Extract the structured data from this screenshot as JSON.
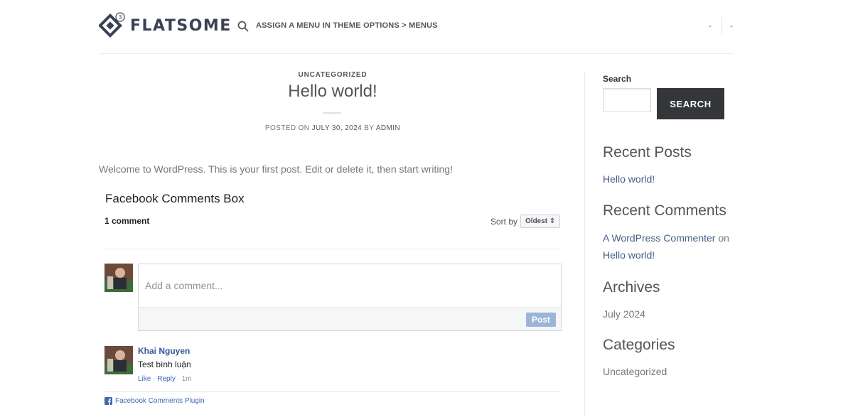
{
  "header": {
    "logo_text": "FLATSOME",
    "logo_version": "3",
    "menu_note": "ASSIGN A MENU IN THEME OPTIONS > MENUS",
    "right_item_1": "-",
    "right_item_2": "-"
  },
  "post": {
    "category": "UNCATEGORIZED",
    "title": "Hello world!",
    "meta_prefix": "POSTED ON",
    "meta_date": "JULY 30, 2024",
    "meta_by": "BY",
    "meta_author": "ADMIN",
    "body": "Welcome to WordPress. This is your first post. Edit or delete it, then start writing!"
  },
  "fb_comments": {
    "title": "Facebook Comments Box",
    "count": "1 comment",
    "sort_label": "Sort by",
    "sort_value": "Oldest",
    "input_placeholder": "Add a comment...",
    "post_button": "Post",
    "comments": [
      {
        "name": "Khai Nguyen",
        "text": "Test bình luận",
        "like": "Like",
        "reply": "Reply",
        "time": "1m"
      }
    ],
    "plugin_label": "Facebook Comments Plugin"
  },
  "sidebar": {
    "search_label": "Search",
    "search_button": "SEARCH",
    "recent_posts_heading": "Recent Posts",
    "recent_posts": [
      "Hello world!"
    ],
    "recent_comments_heading": "Recent Comments",
    "recent_comment_author": "A WordPress Commenter",
    "recent_comment_on": "on",
    "recent_comment_post": "Hello world!",
    "archives_heading": "Archives",
    "archives": [
      "July 2024"
    ],
    "categories_heading": "Categories",
    "categories": [
      "Uncategorized"
    ]
  },
  "colors": {
    "brand_dark": "#3a4154",
    "link": "#446084",
    "fb_link": "#365899",
    "search_button_bg": "#35363a",
    "post_button_bg": "#9cb4d8"
  }
}
